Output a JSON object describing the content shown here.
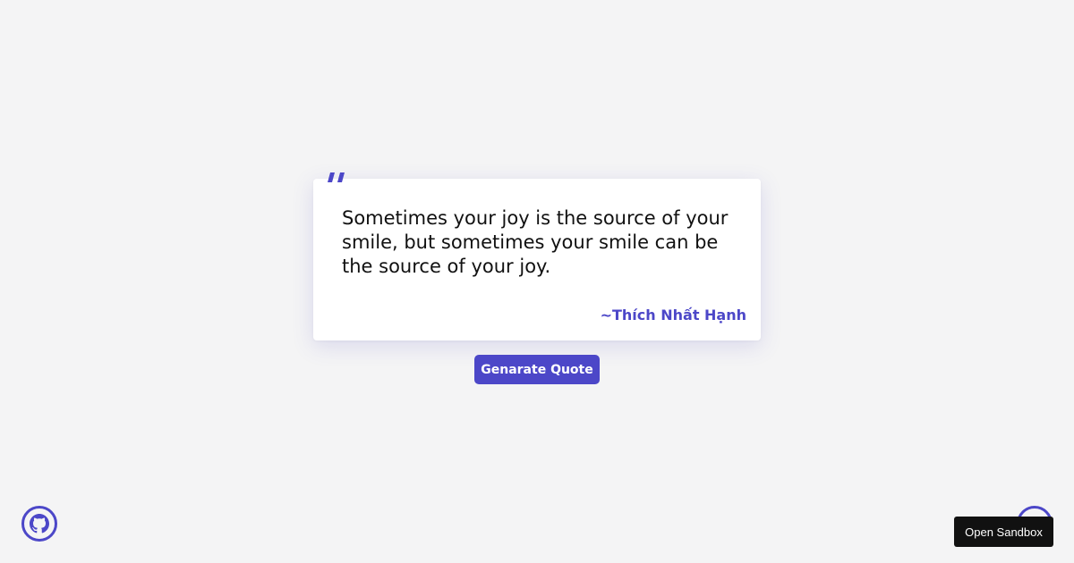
{
  "quote": {
    "text": "Sometimes your joy is the source of your smile, but sometimes your smile can be the source of your joy.",
    "author": "~Thích Nhất Hạnh"
  },
  "actions": {
    "generate_label": "Genarate Quote"
  },
  "corner": {
    "github_icon": "github-icon",
    "sandbox_label": "Open Sandbox"
  },
  "colors": {
    "accent": "#4c47c8",
    "background": "#f4f4f5",
    "card": "#ffffff",
    "text": "#111111",
    "sandbox_button": "#111111"
  }
}
